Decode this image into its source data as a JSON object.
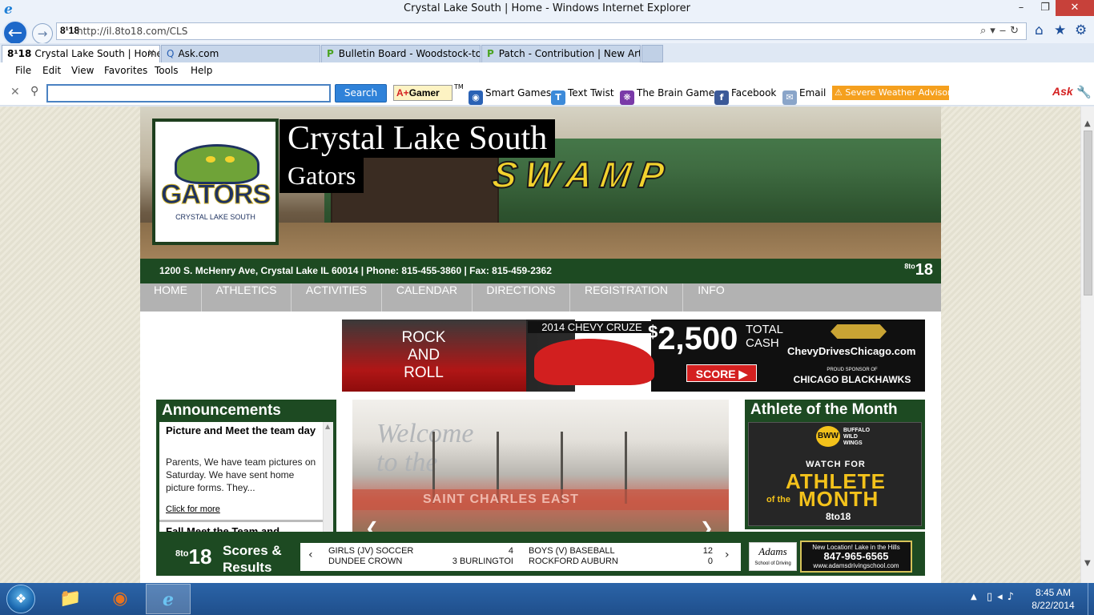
{
  "window": {
    "title": "Crystal Lake South | Home - Windows Internet Explorer",
    "minimize": "–",
    "maximize": "❐",
    "close": "✕"
  },
  "address": {
    "favicon": "8¹18",
    "url": "http://il.8to18.com/CLS",
    "icons": "⌕▾‒↻"
  },
  "tabs": [
    {
      "favicon": "8¹18",
      "label": "Crystal Lake South | Home",
      "close": "✕"
    },
    {
      "favicon": "Q",
      "label": "Ask.com"
    },
    {
      "favicon": "P",
      "label": "Bulletin Board - Woodstock-to..."
    },
    {
      "favicon": "P",
      "label": "Patch - Contribution | New Art..."
    }
  ],
  "menu": [
    "File",
    "Edit",
    "View",
    "Favorites",
    "Tools",
    "Help"
  ],
  "toolbar": {
    "close": "✕",
    "search_input": "",
    "search_button": "Search",
    "gamer_prefix": "A+",
    "gamer_label": "Gamer",
    "gamer_tm": "TM",
    "links": [
      "Smart Games",
      "Text Twist",
      "The Brain Game",
      "Facebook",
      "Email"
    ],
    "advisory": "Severe Weather Advisory",
    "ask": "Ask"
  },
  "site": {
    "logo_text": "GATORS",
    "logo_sub": "CRYSTAL LAKE SOUTH",
    "school_name": "Crystal Lake South",
    "mascot": "Gators",
    "hero_floor_text": "SWAMP",
    "contact": "1200 S. McHenry Ave, Crystal Lake IL 60014 | Phone: 815-455-3860 | Fax: 815-459-2362",
    "brand_top": "8to",
    "brand_bottom": "18",
    "nav": [
      "HOME",
      "ATHLETICS",
      "ACTIVITIES",
      "CALENDAR",
      "DIRECTIONS",
      "REGISTRATION",
      "INFO"
    ]
  },
  "ad": {
    "rock_line1": "ROCK",
    "rock_line2": "AND",
    "rock_line3": "ROLL",
    "car_title": "2014 CHEVY CRUZE",
    "price_symbol": "$",
    "price": "2,500",
    "total_line1": "TOTAL",
    "total_line2": "CASH",
    "site": "ChevyDrivesChicago.com",
    "score_button": "SCORE ▶",
    "sponsor": "PROUD SPONSOR OF",
    "team": "CHICAGO BLACKHAWKS"
  },
  "announcements": {
    "title": "Announcements",
    "item_title": "Picture and Meet the team day",
    "item_text": "Parents, We have team pictures on Saturday. We have sent home picture forms. They...",
    "more": "Click for more",
    "next_title": "Fall Meet the Team and"
  },
  "slideshow": {
    "welcome_line1": "Welcome",
    "welcome_line2": "to the",
    "banner": "SAINT CHARLES EAST",
    "prev": "❮",
    "next": "❯"
  },
  "athlete": {
    "title": "Athlete of the Month",
    "wings_line1": "BUFFALO",
    "wings_line2": "WILD",
    "wings_line3": "WINGS",
    "watch": "WATCH FOR",
    "athlete_word": "ATHLETE",
    "of_the": "of the",
    "month_word": "MONTH",
    "brand": "8to18"
  },
  "scores": {
    "brand_top": "8to",
    "brand_bottom": "18",
    "title_line1": "Scores &",
    "title_line2": "Results",
    "prev": "‹",
    "next": "›",
    "games": [
      {
        "team1": "GIRLS (JV) SOCCER",
        "score1": "4",
        "team2": "DUNDEE CROWN",
        "score2": "3 BURLINGTOI"
      },
      {
        "team1": "BOYS (V) BASEBALL",
        "score1": "12",
        "team2": "ROCKFORD AUBURN",
        "score2": "0"
      }
    ],
    "adams_name": "Adams",
    "adams_sub": "School of Driving",
    "adams_new": "New Location!  Lake in the Hills",
    "adams_phone": "847-965-6565",
    "adams_site": "www.adamsdrivingschool.com"
  },
  "taskbar": {
    "tray_arrow": "▲",
    "tray_icons": "▯◂♪",
    "time": "8:45 AM",
    "date": "8/22/2014"
  }
}
